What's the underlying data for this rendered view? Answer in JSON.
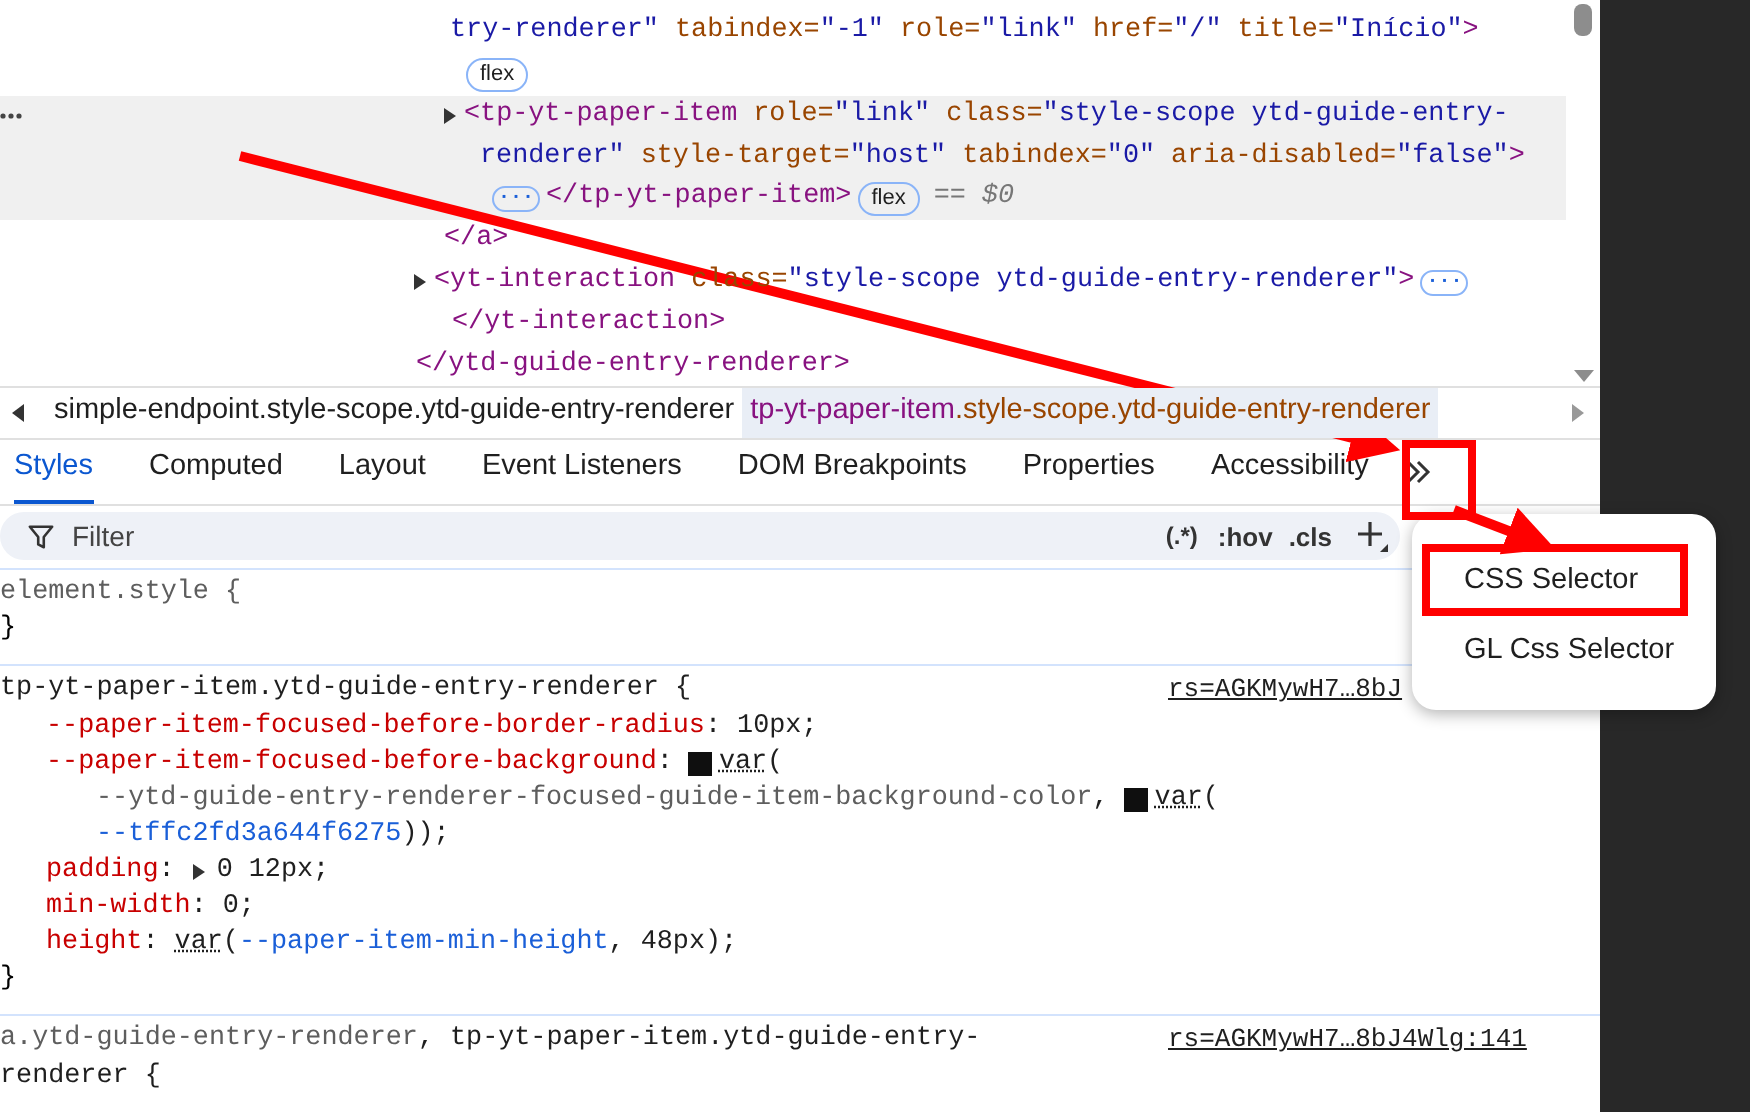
{
  "dom_lines": [
    {
      "selected": false,
      "collapsed": false,
      "tokens": [
        {
          "kind": "value",
          "t": "try-renderer\""
        },
        {
          "kind": "attr",
          "t": " tabindex="
        },
        {
          "kind": "value",
          "t": "\"-1\""
        },
        {
          "kind": "attr",
          "t": " role="
        },
        {
          "kind": "value",
          "t": "\"link\""
        },
        {
          "kind": "attr",
          "t": " href="
        },
        {
          "kind": "value",
          "t": "\"/\""
        },
        {
          "kind": "attr",
          "t": " title="
        },
        {
          "kind": "value",
          "t": "\"Início\""
        },
        {
          "kind": "tag",
          "t": ">"
        }
      ]
    },
    {
      "selected": false,
      "collapsed": false,
      "tokens": [
        {
          "kind": "badge",
          "t": "flex"
        }
      ]
    },
    {
      "selected": true,
      "collapsed": true,
      "tokens": [
        {
          "kind": "tag",
          "t": "<tp-yt-paper-item"
        },
        {
          "kind": "attr",
          "t": " role="
        },
        {
          "kind": "value",
          "t": "\"link\""
        },
        {
          "kind": "attr",
          "t": " class="
        },
        {
          "kind": "value",
          "t": "\"style-scope ytd-guide-entry-"
        }
      ]
    },
    {
      "selected": true,
      "collapsed": false,
      "tokens": [
        {
          "kind": "value",
          "t": "renderer\""
        },
        {
          "kind": "attr",
          "t": " style-target="
        },
        {
          "kind": "value",
          "t": "\"host\""
        },
        {
          "kind": "attr",
          "t": " tabindex="
        },
        {
          "kind": "value",
          "t": "\"0\""
        },
        {
          "kind": "attr",
          "t": " aria-disabled="
        },
        {
          "kind": "value",
          "t": "\"false\""
        },
        {
          "kind": "tag",
          "t": ">"
        }
      ]
    },
    {
      "selected": true,
      "collapsed": false,
      "tokens": [
        {
          "kind": "more",
          "t": "···"
        },
        {
          "kind": "tag",
          "t": "</tp-yt-paper-item>"
        },
        {
          "kind": "badge",
          "t": "flex"
        },
        {
          "kind": "dollar",
          "t": "== $0"
        }
      ]
    },
    {
      "selected": false,
      "collapsed": false,
      "tokens": [
        {
          "kind": "tag",
          "t": "</a>"
        }
      ]
    },
    {
      "selected": false,
      "collapsed": true,
      "tokens": [
        {
          "kind": "tag",
          "t": "<yt-interaction"
        },
        {
          "kind": "attr",
          "t": " class="
        },
        {
          "kind": "value",
          "t": "\"style-scope ytd-guide-entry-renderer\""
        },
        {
          "kind": "tag",
          "t": ">"
        },
        {
          "kind": "more",
          "t": "···"
        }
      ]
    },
    {
      "selected": false,
      "collapsed": false,
      "tokens": [
        {
          "kind": "tag",
          "t": "</yt-interaction>"
        }
      ]
    },
    {
      "selected": false,
      "collapsed": false,
      "tokens": [
        {
          "kind": "tag",
          "t": "</ytd-guide-entry-renderer>"
        }
      ]
    }
  ],
  "breadcrumbs": [
    {
      "selected": false,
      "tag": "simple-endpoint",
      "rest": ".style-scope.ytd-guide-entry-renderer"
    },
    {
      "selected": true,
      "tag": "tp-yt-paper-item",
      "rest": ".style-scope.ytd-guide-entry-renderer"
    }
  ],
  "tabs": [
    {
      "label": "Styles",
      "selected": true
    },
    {
      "label": "Computed",
      "selected": false
    },
    {
      "label": "Layout",
      "selected": false
    },
    {
      "label": "Event Listeners",
      "selected": false
    },
    {
      "label": "DOM Breakpoints",
      "selected": false
    },
    {
      "label": "Properties",
      "selected": false
    },
    {
      "label": "Accessibility",
      "selected": false
    }
  ],
  "filter": {
    "placeholder": "Filter",
    "regex": "(.*)",
    "hov": ":hov",
    "cls": ".cls"
  },
  "menu": [
    "CSS Selector",
    "GL Css Selector"
  ],
  "rules": [
    {
      "selector": [
        [
          {
            "kind": "dim",
            "t": "element.style {"
          }
        ]
      ]
    },
    {
      "selector": [
        [
          {
            "kind": "plain",
            "t": "tp-yt-paper-item.ytd-guide-entry-renderer {"
          }
        ]
      ],
      "source": "rs=AGKMywH7…8bJ",
      "lines": [
        {
          "kind": "decl",
          "tokens": [
            {
              "kind": "prop",
              "t": "--paper-item-focused-before-border-radius"
            },
            {
              "kind": "plain",
              "t": ": 10px;"
            }
          ]
        },
        {
          "kind": "decl",
          "tokens": [
            {
              "kind": "prop",
              "t": "--paper-item-focused-before-background"
            },
            {
              "kind": "plain",
              "t": ": "
            },
            {
              "kind": "swatch",
              "color": "#0f0f0f"
            },
            {
              "kind": "func",
              "t": "var"
            },
            {
              "kind": "plain",
              "t": "("
            }
          ]
        },
        {
          "kind": "cont",
          "tokens": [
            {
              "kind": "dim",
              "t": "--ytd-guide-entry-renderer-focused-guide-item-background-color"
            },
            {
              "kind": "plain",
              "t": ", "
            },
            {
              "kind": "swatch",
              "color": "#0f0f0f"
            },
            {
              "kind": "func",
              "t": "var"
            },
            {
              "kind": "plain",
              "t": "("
            }
          ]
        },
        {
          "kind": "cont",
          "tokens": [
            {
              "kind": "ref",
              "t": "--tffc2fd3a644f6275"
            },
            {
              "kind": "plain",
              "t": "));"
            }
          ]
        },
        {
          "kind": "decl",
          "tokens": [
            {
              "kind": "prop",
              "t": "padding"
            },
            {
              "kind": "plain",
              "t": ": "
            },
            {
              "kind": "tri"
            },
            {
              "kind": "plain",
              "t": "0 12px;"
            }
          ]
        },
        {
          "kind": "decl",
          "tokens": [
            {
              "kind": "prop",
              "t": "min-width"
            },
            {
              "kind": "plain",
              "t": ": 0;"
            }
          ]
        },
        {
          "kind": "decl",
          "tokens": [
            {
              "kind": "prop",
              "t": "height"
            },
            {
              "kind": "plain",
              "t": ": "
            },
            {
              "kind": "func",
              "t": "var"
            },
            {
              "kind": "plain",
              "t": "("
            },
            {
              "kind": "ref",
              "t": "--paper-item-min-height"
            },
            {
              "kind": "plain",
              "t": ", 48px);"
            }
          ]
        }
      ]
    },
    {
      "selector": [
        [
          {
            "kind": "dim",
            "t": "a.ytd-guide-entry-renderer"
          },
          {
            "kind": "plain",
            "t": ", tp-yt-paper-item.ytd-guide-entry-"
          }
        ],
        [
          {
            "kind": "plain",
            "t": "renderer {"
          }
        ]
      ],
      "source": "rs=AGKMywH7…8bJ4Wlg:141"
    }
  ],
  "closing_brace": "}"
}
